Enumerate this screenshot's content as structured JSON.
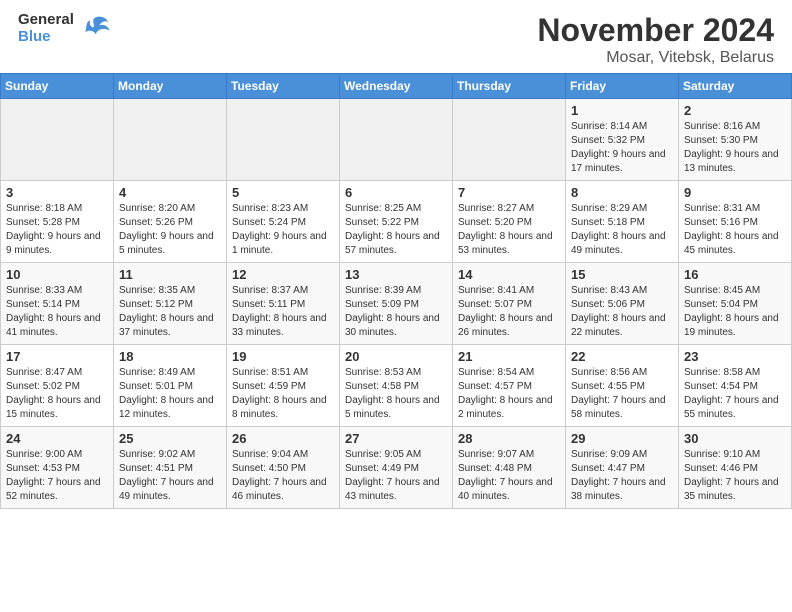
{
  "logo": {
    "general": "General",
    "blue": "Blue"
  },
  "header": {
    "title": "November 2024",
    "subtitle": "Mosar, Vitebsk, Belarus"
  },
  "weekdays": [
    "Sunday",
    "Monday",
    "Tuesday",
    "Wednesday",
    "Thursday",
    "Friday",
    "Saturday"
  ],
  "weeks": [
    [
      {
        "day": "",
        "info": ""
      },
      {
        "day": "",
        "info": ""
      },
      {
        "day": "",
        "info": ""
      },
      {
        "day": "",
        "info": ""
      },
      {
        "day": "",
        "info": ""
      },
      {
        "day": "1",
        "info": "Sunrise: 8:14 AM\nSunset: 5:32 PM\nDaylight: 9 hours and 17 minutes."
      },
      {
        "day": "2",
        "info": "Sunrise: 8:16 AM\nSunset: 5:30 PM\nDaylight: 9 hours and 13 minutes."
      }
    ],
    [
      {
        "day": "3",
        "info": "Sunrise: 8:18 AM\nSunset: 5:28 PM\nDaylight: 9 hours and 9 minutes."
      },
      {
        "day": "4",
        "info": "Sunrise: 8:20 AM\nSunset: 5:26 PM\nDaylight: 9 hours and 5 minutes."
      },
      {
        "day": "5",
        "info": "Sunrise: 8:23 AM\nSunset: 5:24 PM\nDaylight: 9 hours and 1 minute."
      },
      {
        "day": "6",
        "info": "Sunrise: 8:25 AM\nSunset: 5:22 PM\nDaylight: 8 hours and 57 minutes."
      },
      {
        "day": "7",
        "info": "Sunrise: 8:27 AM\nSunset: 5:20 PM\nDaylight: 8 hours and 53 minutes."
      },
      {
        "day": "8",
        "info": "Sunrise: 8:29 AM\nSunset: 5:18 PM\nDaylight: 8 hours and 49 minutes."
      },
      {
        "day": "9",
        "info": "Sunrise: 8:31 AM\nSunset: 5:16 PM\nDaylight: 8 hours and 45 minutes."
      }
    ],
    [
      {
        "day": "10",
        "info": "Sunrise: 8:33 AM\nSunset: 5:14 PM\nDaylight: 8 hours and 41 minutes."
      },
      {
        "day": "11",
        "info": "Sunrise: 8:35 AM\nSunset: 5:12 PM\nDaylight: 8 hours and 37 minutes."
      },
      {
        "day": "12",
        "info": "Sunrise: 8:37 AM\nSunset: 5:11 PM\nDaylight: 8 hours and 33 minutes."
      },
      {
        "day": "13",
        "info": "Sunrise: 8:39 AM\nSunset: 5:09 PM\nDaylight: 8 hours and 30 minutes."
      },
      {
        "day": "14",
        "info": "Sunrise: 8:41 AM\nSunset: 5:07 PM\nDaylight: 8 hours and 26 minutes."
      },
      {
        "day": "15",
        "info": "Sunrise: 8:43 AM\nSunset: 5:06 PM\nDaylight: 8 hours and 22 minutes."
      },
      {
        "day": "16",
        "info": "Sunrise: 8:45 AM\nSunset: 5:04 PM\nDaylight: 8 hours and 19 minutes."
      }
    ],
    [
      {
        "day": "17",
        "info": "Sunrise: 8:47 AM\nSunset: 5:02 PM\nDaylight: 8 hours and 15 minutes."
      },
      {
        "day": "18",
        "info": "Sunrise: 8:49 AM\nSunset: 5:01 PM\nDaylight: 8 hours and 12 minutes."
      },
      {
        "day": "19",
        "info": "Sunrise: 8:51 AM\nSunset: 4:59 PM\nDaylight: 8 hours and 8 minutes."
      },
      {
        "day": "20",
        "info": "Sunrise: 8:53 AM\nSunset: 4:58 PM\nDaylight: 8 hours and 5 minutes."
      },
      {
        "day": "21",
        "info": "Sunrise: 8:54 AM\nSunset: 4:57 PM\nDaylight: 8 hours and 2 minutes."
      },
      {
        "day": "22",
        "info": "Sunrise: 8:56 AM\nSunset: 4:55 PM\nDaylight: 7 hours and 58 minutes."
      },
      {
        "day": "23",
        "info": "Sunrise: 8:58 AM\nSunset: 4:54 PM\nDaylight: 7 hours and 55 minutes."
      }
    ],
    [
      {
        "day": "24",
        "info": "Sunrise: 9:00 AM\nSunset: 4:53 PM\nDaylight: 7 hours and 52 minutes."
      },
      {
        "day": "25",
        "info": "Sunrise: 9:02 AM\nSunset: 4:51 PM\nDaylight: 7 hours and 49 minutes."
      },
      {
        "day": "26",
        "info": "Sunrise: 9:04 AM\nSunset: 4:50 PM\nDaylight: 7 hours and 46 minutes."
      },
      {
        "day": "27",
        "info": "Sunrise: 9:05 AM\nSunset: 4:49 PM\nDaylight: 7 hours and 43 minutes."
      },
      {
        "day": "28",
        "info": "Sunrise: 9:07 AM\nSunset: 4:48 PM\nDaylight: 7 hours and 40 minutes."
      },
      {
        "day": "29",
        "info": "Sunrise: 9:09 AM\nSunset: 4:47 PM\nDaylight: 7 hours and 38 minutes."
      },
      {
        "day": "30",
        "info": "Sunrise: 9:10 AM\nSunset: 4:46 PM\nDaylight: 7 hours and 35 minutes."
      }
    ]
  ]
}
